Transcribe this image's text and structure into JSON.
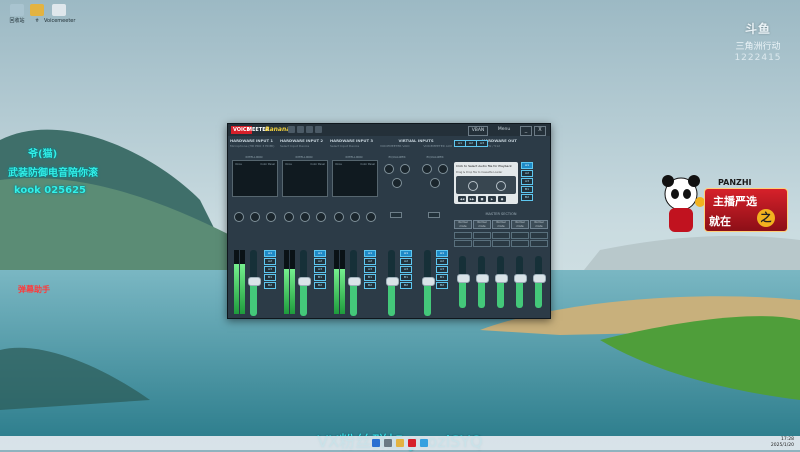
{
  "desktop": {
    "icons": [
      {
        "label": "回收站",
        "icon": "recycle-bin-icon",
        "color": "#a9c4d0"
      },
      {
        "label": "ㅎ",
        "icon": "folder-icon",
        "color": "#e3b341"
      },
      {
        "label": "Voicemeeter",
        "icon": "file-icon",
        "color": "#dfe7ec"
      }
    ]
  },
  "overlays": {
    "douyu": {
      "brand": "斗鱼",
      "cn": "三角洲行动",
      "num": "1222415"
    },
    "neon_line_1": "爷(猫)",
    "neon_line_2": "武装防御电音陪你滚",
    "neon_line_3": "kook 025625",
    "red_text": "弹幕助手",
    "panda_name": "PANZHI",
    "badge_top": "主播严选",
    "badge_bot": "就在",
    "badge_suffix": "之",
    "subtitle": "VX粉丝群加 yaoziSYQ"
  },
  "voicemeeter": {
    "logo": {
      "a": "VOICE",
      "b": "MEETER",
      "c": "Banana"
    },
    "vban": "VBAN",
    "menu": "Menu",
    "min": "_",
    "close": "X",
    "strips": [
      {
        "title": "HARDWARE INPUT 1",
        "sub": "Microphone (HD PRO 3 HDMI)",
        "intelli": "INTELLIPAN",
        "pad_l": "Voice",
        "pad_r": "Color Panel",
        "gain_label": "Fader Gain",
        "buses": [
          "A1",
          "A2",
          "A3",
          "B1",
          "B2"
        ],
        "meter": 0.78,
        "fader": 0.52
      },
      {
        "title": "HARDWARE INPUT 2",
        "sub": "Select Input Device",
        "intelli": "INTELLIPAN",
        "pad_l": "Voice",
        "pad_r": "Color Panel",
        "gain_label": "Fader Gain",
        "buses": [
          "A1",
          "A2",
          "A3",
          "B1",
          "B2"
        ],
        "meter": 0.7,
        "fader": 0.52
      },
      {
        "title": "HARDWARE INPUT 3",
        "sub": "Select Input Device",
        "intelli": "INTELLIPAN",
        "pad_l": "Voice",
        "pad_r": "Color Panel",
        "gain_label": "Fader Gain",
        "buses": [
          "A1",
          "A2",
          "A3",
          "B1",
          "B2"
        ],
        "meter": 0.7,
        "fader": 0.52
      }
    ],
    "virtual": {
      "title": "VIRTUAL INPUTS",
      "sub1": "VOICEMEETER VAIO",
      "sub2": "VOICEMEETER AUX",
      "eq": "EQUALIZER",
      "strips": [
        {
          "gain_label": "Fader Gain",
          "buses": [
            "A1",
            "A2",
            "A3",
            "B1",
            "B2"
          ],
          "fader": 0.52
        },
        {
          "gain_label": "Fader Gain",
          "buses": [
            "A1",
            "A2",
            "A3",
            "B1",
            "B2"
          ],
          "fader": 0.52
        }
      ]
    },
    "hw_out": {
      "title": "HARDWARE OUT",
      "sub": "48kHz / 512",
      "buses": [
        "A1",
        "A2",
        "A3"
      ]
    },
    "cassette": {
      "head": "Click to Select Audio file for Playback",
      "sub": "Drag & Drop file to Cassette Loader"
    },
    "outputs": [
      "A1",
      "A2",
      "A3",
      "B1",
      "B2"
    ],
    "master_section": "MASTER SECTION",
    "master_heads": [
      "Normal mode",
      "Normal mode",
      "Normal mode",
      "Normal mode",
      "Normal mode"
    ],
    "master_faders": [
      0.55,
      0.55,
      0.55,
      0.55,
      0.55
    ]
  },
  "taskbar": {
    "time": "17:28",
    "date": "2025/1/20"
  },
  "colors": {
    "accent_green": "#44c87a",
    "neon": "#33f0e8",
    "bus_blue": "#1e8ac7"
  }
}
